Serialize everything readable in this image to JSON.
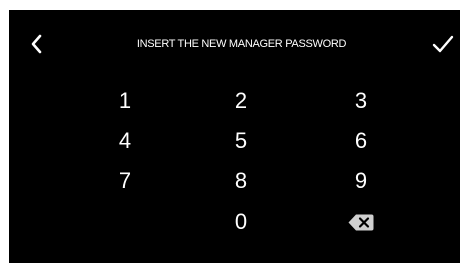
{
  "header": {
    "title": "INSERT THE NEW MANAGER PASSWORD",
    "back_icon": "chevron-left-icon",
    "confirm_icon": "checkmark-icon"
  },
  "keypad": {
    "keys": {
      "k1": "1",
      "k2": "2",
      "k3": "3",
      "k4": "4",
      "k5": "5",
      "k6": "6",
      "k7": "7",
      "k8": "8",
      "k9": "9",
      "k0": "0"
    },
    "delete_icon": "backspace-icon"
  },
  "colors": {
    "background": "#000000",
    "text": "#ffffff",
    "delete_key": "#cfcfcf"
  }
}
